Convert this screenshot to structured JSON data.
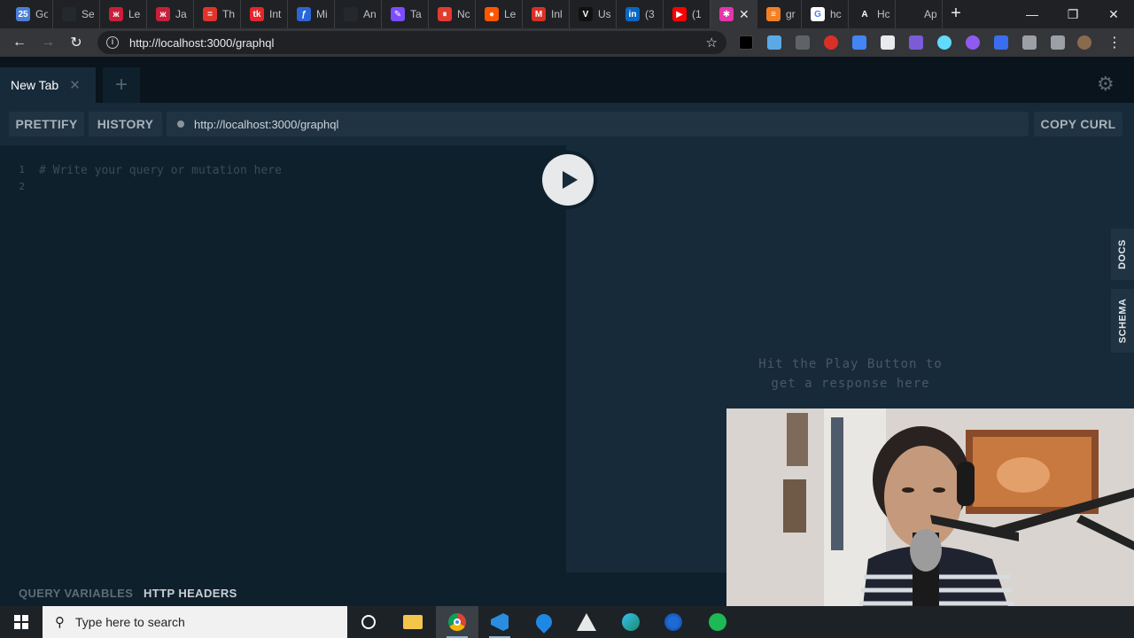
{
  "browser": {
    "tabs": [
      {
        "title": "Go",
        "favicon_color": "#4a7fd6",
        "favicon_glyph": "25"
      },
      {
        "title": "Se",
        "favicon_color": "#24292e",
        "favicon_glyph": ""
      },
      {
        "title": "Le",
        "favicon_color": "#c91f3b",
        "favicon_glyph": "ж"
      },
      {
        "title": "Ja",
        "favicon_color": "#c91f3b",
        "favicon_glyph": "ж"
      },
      {
        "title": "Th",
        "favicon_color": "#e0342a",
        "favicon_glyph": "="
      },
      {
        "title": "Int",
        "favicon_color": "#e3272b",
        "favicon_glyph": "tk"
      },
      {
        "title": "Mi",
        "favicon_color": "#2a66d8",
        "favicon_glyph": "ƒ"
      },
      {
        "title": "An",
        "favicon_color": "#24292e",
        "favicon_glyph": ""
      },
      {
        "title": "Ta",
        "favicon_color": "#7c4dff",
        "favicon_glyph": "✎"
      },
      {
        "title": "Nc",
        "favicon_color": "#e23c2f",
        "favicon_glyph": "⏸"
      },
      {
        "title": "Le",
        "favicon_color": "#ff5700",
        "favicon_glyph": "●"
      },
      {
        "title": "Inl",
        "favicon_color": "#d93025",
        "favicon_glyph": "M"
      },
      {
        "title": "Us",
        "favicon_color": "#111111",
        "favicon_glyph": "V"
      },
      {
        "title": "(3",
        "favicon_color": "#0a66c2",
        "favicon_glyph": "in"
      },
      {
        "title": "(1",
        "favicon_color": "#ff0000",
        "favicon_glyph": "▶"
      },
      {
        "title": "",
        "favicon_color": "#e535ab",
        "favicon_glyph": "✱",
        "active": true
      },
      {
        "title": "gr",
        "favicon_color": "#f48024",
        "favicon_glyph": "≡"
      },
      {
        "title": "hc",
        "favicon_color": "#ffffff",
        "favicon_glyph": "G"
      },
      {
        "title": "Hc",
        "favicon_color": "#202124",
        "favicon_glyph": "A"
      },
      {
        "title": "Ap",
        "favicon_color": "#202124",
        "favicon_glyph": ""
      }
    ],
    "url": "http://localhost:3000/graphql"
  },
  "playground": {
    "tab_label": "New Tab",
    "prettify_label": "PRETTIFY",
    "history_label": "HISTORY",
    "endpoint_url": "http://localhost:3000/graphql",
    "copy_curl_label": "COPY CURL",
    "line_numbers": [
      "1",
      "2"
    ],
    "editor_placeholder": "# Write your query or mutation here",
    "result_hint_line1": "Hit the Play Button to",
    "result_hint_line2": "get a response here",
    "docs_label": "DOCS",
    "schema_label": "SCHEMA",
    "query_variables_label": "QUERY VARIABLES",
    "http_headers_label": "HTTP HEADERS"
  },
  "taskbar": {
    "search_placeholder": "Type here to search"
  }
}
